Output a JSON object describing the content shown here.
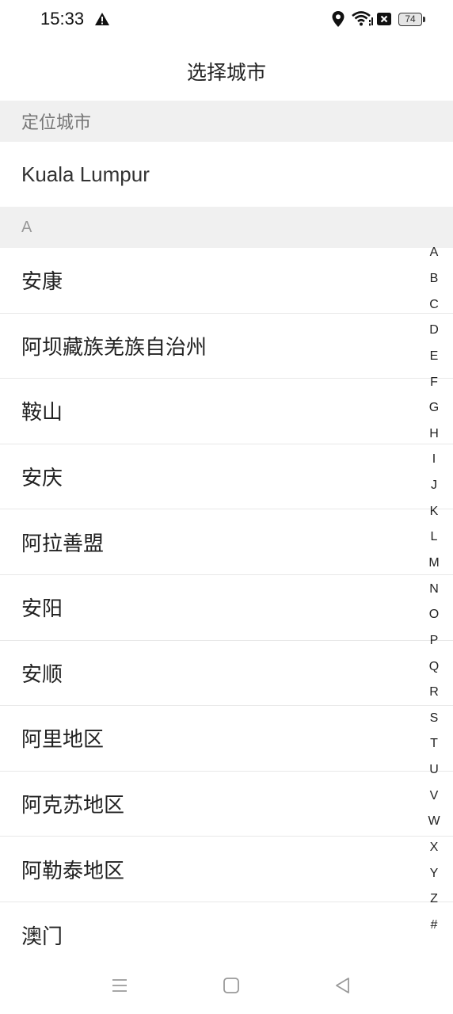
{
  "status_bar": {
    "time": "15:33",
    "battery_level": "74",
    "icons": [
      "warning-icon",
      "location-icon",
      "wifi-icon",
      "sim-blocked-icon",
      "battery-icon"
    ]
  },
  "header": {
    "title": "选择城市"
  },
  "located_section": {
    "header": "定位城市",
    "city": "Kuala Lumpur"
  },
  "section_a": {
    "header": "A",
    "cities": [
      "安康",
      "阿坝藏族羌族自治州",
      "鞍山",
      "安庆",
      "阿拉善盟",
      "安阳",
      "安顺",
      "阿里地区",
      "阿克苏地区",
      "阿勒泰地区",
      "澳门"
    ]
  },
  "index_bar": {
    "letters": [
      "A",
      "B",
      "C",
      "D",
      "E",
      "F",
      "G",
      "H",
      "I",
      "J",
      "K",
      "L",
      "M",
      "N",
      "O",
      "P",
      "Q",
      "R",
      "S",
      "T",
      "U",
      "V",
      "W",
      "X",
      "Y",
      "Z",
      "#"
    ]
  },
  "nav_bar": {
    "icons": [
      "menu-icon",
      "home-icon",
      "back-icon"
    ]
  }
}
